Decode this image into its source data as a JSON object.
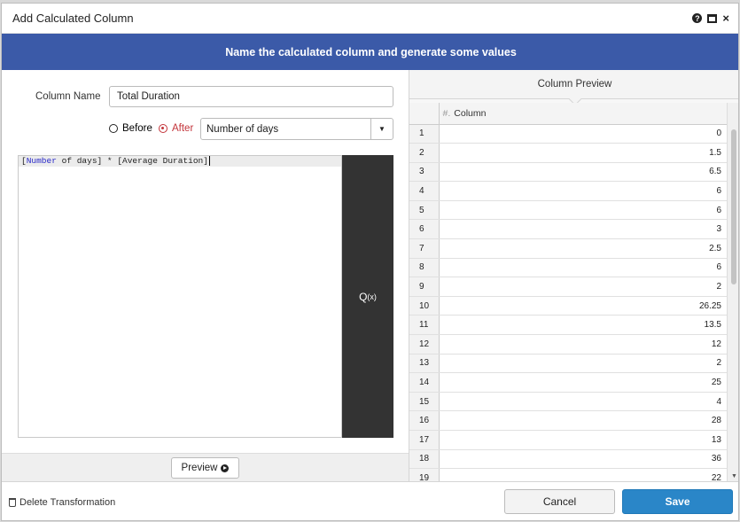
{
  "dialog": {
    "title": "Add Calculated Column",
    "help_glyph": "?",
    "close_glyph": "×"
  },
  "banner": {
    "text": "Name the calculated column and generate some values"
  },
  "form": {
    "column_name_label": "Column Name",
    "column_name_value": "Total Duration",
    "position": {
      "before_label": "Before",
      "after_label": "After",
      "selected": "after"
    },
    "anchor_column": "Number of days",
    "anchor_arrow": "▼"
  },
  "editor": {
    "kw": "Number",
    "rest": " of days] * [Average Duration]",
    "open": "["
  },
  "formula_button": {
    "label": "Q",
    "sub": "(x)"
  },
  "preview_button": {
    "label": "Preview"
  },
  "preview": {
    "title": "Column Preview",
    "hash": "#.",
    "column_header": "Column",
    "rows": [
      [
        "1",
        "0"
      ],
      [
        "2",
        "1.5"
      ],
      [
        "3",
        "6.5"
      ],
      [
        "4",
        "6"
      ],
      [
        "5",
        "6"
      ],
      [
        "6",
        "3"
      ],
      [
        "7",
        "2.5"
      ],
      [
        "8",
        "6"
      ],
      [
        "9",
        "2"
      ],
      [
        "10",
        "26.25"
      ],
      [
        "11",
        "13.5"
      ],
      [
        "12",
        "12"
      ],
      [
        "13",
        "2"
      ],
      [
        "14",
        "25"
      ],
      [
        "15",
        "4"
      ],
      [
        "16",
        "28"
      ],
      [
        "17",
        "13"
      ],
      [
        "18",
        "36"
      ],
      [
        "19",
        "22"
      ]
    ]
  },
  "footer": {
    "delete_label": "Delete Transformation",
    "cancel_label": "Cancel",
    "save_label": "Save"
  },
  "colors": {
    "banner": "#3b5aa8",
    "save": "#2a86c8",
    "accent_red": "#c3343a"
  }
}
